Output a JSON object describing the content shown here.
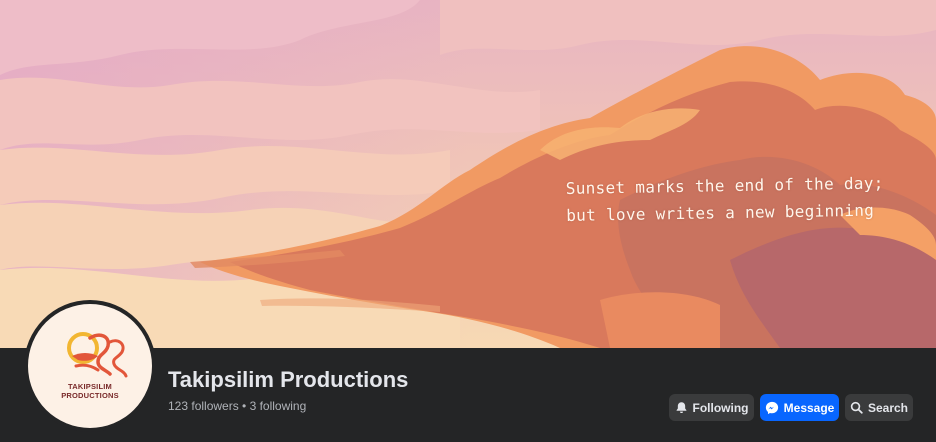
{
  "cover": {
    "quote_line1": "Sunset marks the end of the day;",
    "quote_line2": "but love writes a new beginning"
  },
  "page": {
    "name": "Takipsilim Productions",
    "stats": "123 followers • 3 following",
    "logo_text_line1": "TAKIPSILIM",
    "logo_text_line2": "PRODUCTIONS"
  },
  "actions": {
    "following_label": "Following",
    "message_label": "Message",
    "search_label": "Search"
  },
  "icons": {
    "following": "bell-icon",
    "message": "messenger-icon",
    "search": "search-icon"
  },
  "colors": {
    "background": "#242526",
    "primary_button": "#0866ff",
    "secondary_button": "#3a3b3c",
    "text_primary": "#e4e6eb",
    "text_secondary": "#b0b3b8"
  }
}
